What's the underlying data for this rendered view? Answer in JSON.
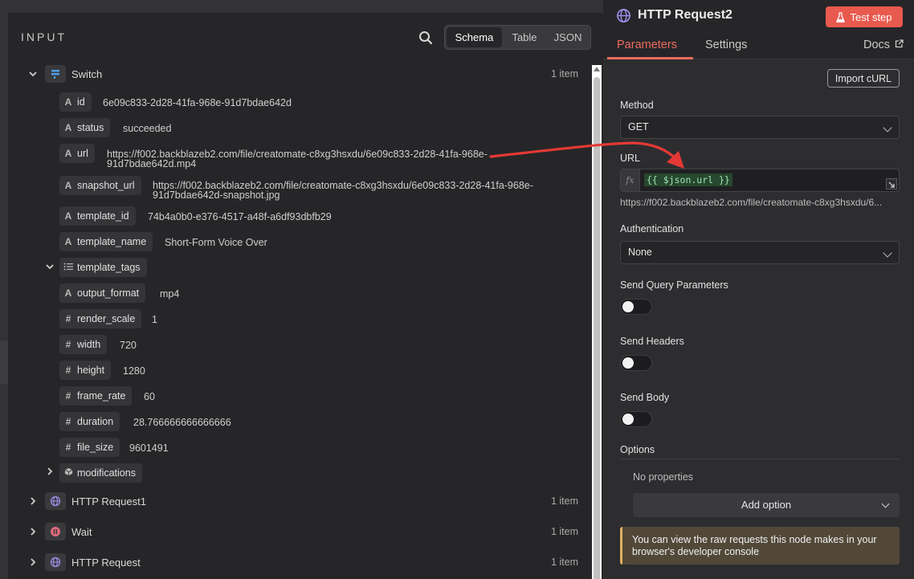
{
  "input_panel": {
    "title": "INPUT",
    "view_tabs": [
      "Schema",
      "Table",
      "JSON"
    ],
    "active_view": "Schema"
  },
  "tree": {
    "switch_node": {
      "name": "Switch",
      "count": "1 item"
    },
    "fields": [
      {
        "type": "A",
        "key": "id",
        "value": "6e09c833-2d28-41fa-968e-91d7bdae642d"
      },
      {
        "type": "A",
        "key": "status",
        "value": "succeeded"
      },
      {
        "type": "A",
        "key": "url",
        "value_l1": "https://f002.backblazeb2.com/file/creatomate-c8xg3hsxdu/6e09c833-2d28-41fa-968e-",
        "value_l2": "91d7bdae642d.mp4"
      },
      {
        "type": "A",
        "key": "snapshot_url",
        "value_l1": "https://f002.backblazeb2.com/file/creatomate-c8xg3hsxdu/6e09c833-2d28-41fa-968e-",
        "value_l2": "91d7bdae642d-snapshot.jpg"
      },
      {
        "type": "A",
        "key": "template_id",
        "value": "74b4a0b0-e376-4517-a48f-a6df93dbfb29"
      },
      {
        "type": "A",
        "key": "template_name",
        "value": "Short-Form Voice Over"
      }
    ],
    "template_tags": {
      "key": "template_tags"
    },
    "sub_fields": [
      {
        "type": "A",
        "key": "output_format",
        "value": "mp4"
      },
      {
        "type": "#",
        "key": "render_scale",
        "value": "1"
      },
      {
        "type": "#",
        "key": "width",
        "value": "720"
      },
      {
        "type": "#",
        "key": "height",
        "value": "1280"
      },
      {
        "type": "#",
        "key": "frame_rate",
        "value": "60"
      },
      {
        "type": "#",
        "key": "duration",
        "value": "28.766666666666666"
      },
      {
        "type": "#",
        "key": "file_size",
        "value": "9601491"
      }
    ],
    "modifications": {
      "key": "modifications"
    },
    "other_nodes": [
      {
        "name": "HTTP Request1",
        "count": "1 item",
        "icon": "globe-icon"
      },
      {
        "name": "Wait",
        "count": "1 item",
        "icon": "pause-icon"
      },
      {
        "name": "HTTP Request",
        "count": "1 item",
        "icon": "globe-icon"
      }
    ]
  },
  "node_panel": {
    "title": "HTTP Request2",
    "test_button": "Test step",
    "tabs": {
      "parameters": "Parameters",
      "settings": "Settings",
      "docs": "Docs"
    },
    "import_curl": "Import cURL",
    "method_label": "Method",
    "method_value": "GET",
    "url_label": "URL",
    "url_fx": "fx",
    "url_expression": "{{ $json.url }}",
    "url_preview": "https://f002.backblazeb2.com/file/creatomate-c8xg3hsxdu/6...",
    "auth_label": "Authentication",
    "auth_value": "None",
    "send_query_label": "Send Query Parameters",
    "send_headers_label": "Send Headers",
    "send_body_label": "Send Body",
    "options_label": "Options",
    "no_properties": "No properties",
    "add_option": "Add option",
    "notice": "You can view the raw requests this node makes in your browser's developer console"
  },
  "colors": {
    "accent": "#ef6b5f",
    "test_button": "#e8594e",
    "notice_bg": "#514838",
    "notice_border": "#e0b060",
    "arrow": "#e53935",
    "expression_text": "#9ee3b0"
  }
}
